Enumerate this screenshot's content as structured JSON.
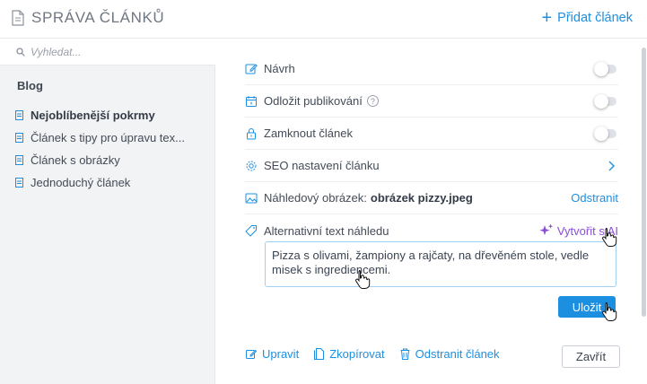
{
  "header": {
    "title": "SPRÁVA ČLÁNKŮ",
    "add_label": "Přidat článek",
    "accent_color": "#1c8fe0"
  },
  "sidebar": {
    "search_placeholder": "Vyhledat...",
    "group_title": "Blog",
    "items": [
      {
        "label": "Nejoblíbenější pokrmy",
        "active": true
      },
      {
        "label": "Článek s tipy pro úpravu tex..."
      },
      {
        "label": "Článek s obrázky"
      },
      {
        "label": "Jednoduchý článek"
      }
    ]
  },
  "settings": {
    "draft": {
      "label": "Návrh",
      "on": false
    },
    "schedule": {
      "label": "Odložit publikování",
      "help_icon": "?",
      "on": false
    },
    "lock": {
      "label": "Zamknout článek",
      "on": false
    },
    "seo": {
      "label": "SEO nastavení článku"
    },
    "preview_image": {
      "label": "Náhledový obrázek:",
      "filename": "obrázek pizzy.jpeg",
      "remove_label": "Odstranit"
    },
    "alt_text": {
      "label": "Alternativní text náhledu",
      "ai_label": "Vytvořit s AI",
      "ai_color": "#8a4fd6"
    }
  },
  "alt_text_value": "Pizza s olivami, žampiony a rajčaty, na dřevěném stole, vedle misek s ingrediencemi.",
  "save_label": "Uložit",
  "actions": {
    "edit": "Upravit",
    "copy": "Zkopírovat",
    "delete": "Odstranit článek",
    "close": "Zavřít"
  }
}
